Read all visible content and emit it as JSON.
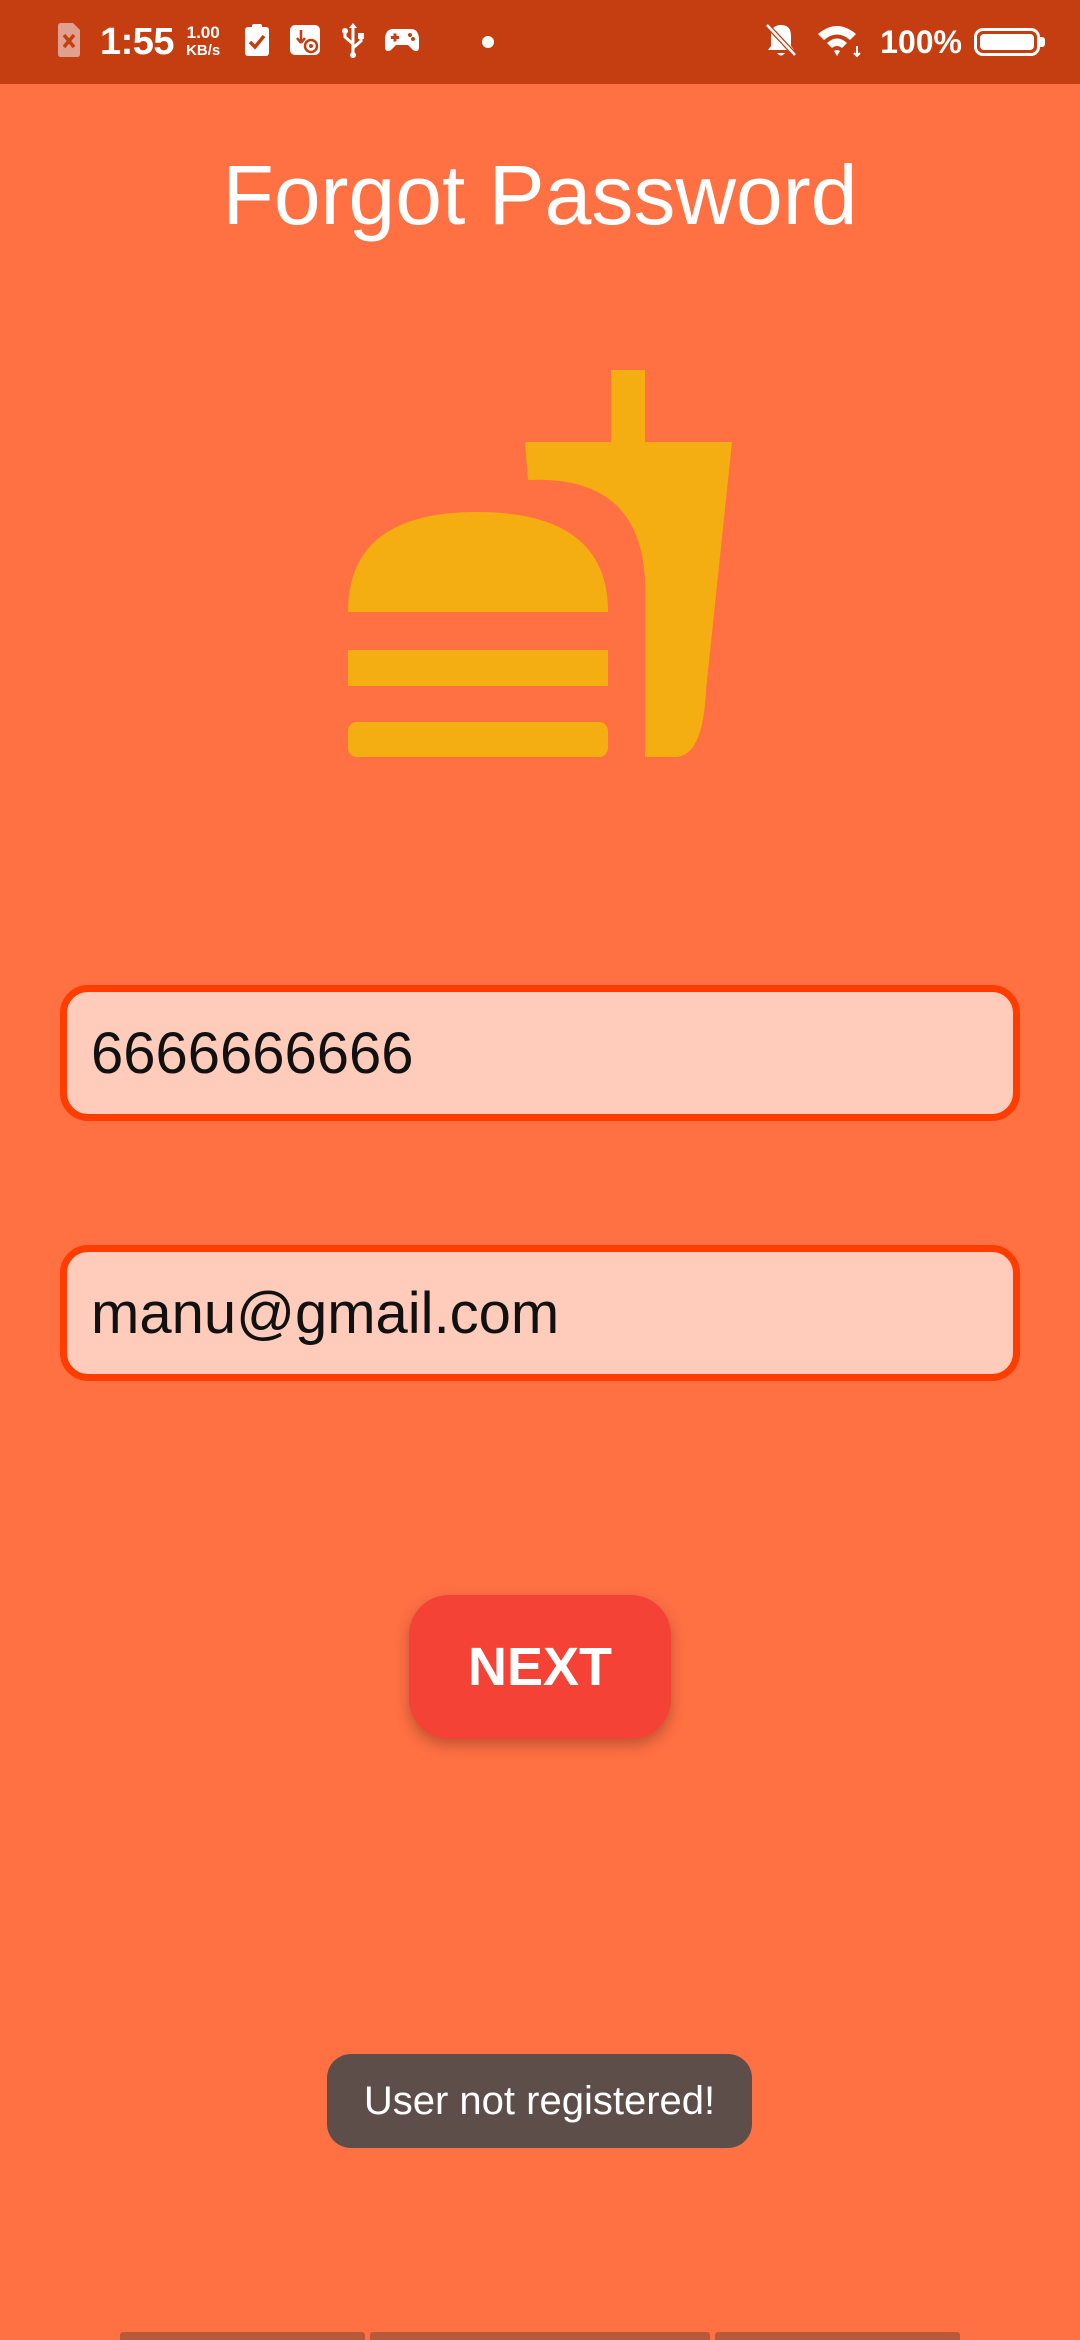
{
  "status_bar": {
    "time": "1:55",
    "speed_value": "1.00",
    "speed_unit": "KB/s",
    "battery": "100%",
    "icons": [
      "sim-error-icon",
      "clipboard-check-icon",
      "usb-settings-icon",
      "usb-icon",
      "gamepad-icon",
      "notification-dot-icon",
      "bell-off-icon",
      "wifi-icon",
      "battery-icon"
    ]
  },
  "page": {
    "title": "Forgot Password",
    "logo_icon": "fastfood-icon"
  },
  "form": {
    "phone_value": "6666666666",
    "email_value": "manu@gmail.com",
    "next_label": "NEXT"
  },
  "toast": {
    "message": "User not registered!"
  },
  "colors": {
    "background": "#FF7043",
    "status_bar": "#C43E12",
    "logo": "#F4AE11",
    "field_fill": "#FFCCBC",
    "field_border": "#FF3D00",
    "button": "#F44336",
    "toast": "#5D4E49"
  }
}
